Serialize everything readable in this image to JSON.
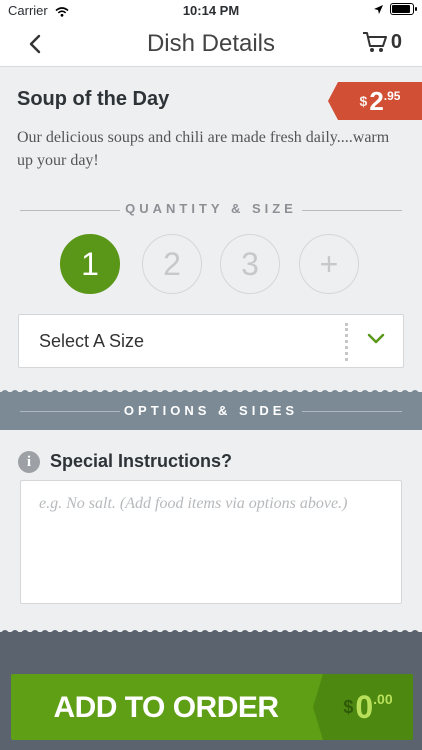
{
  "status_bar": {
    "carrier": "Carrier",
    "time": "10:14 PM"
  },
  "nav": {
    "title": "Dish Details",
    "cart_count": "0"
  },
  "dish": {
    "name": "Soup of the Day",
    "price_currency": "$",
    "price_whole": "2",
    "price_cents": ".95",
    "description": "Our delicious soups and chili are made fresh daily....warm up your day!"
  },
  "quantity": {
    "section_label": "QUANTITY & SIZE",
    "options": [
      "1",
      "2",
      "3",
      "+"
    ],
    "selected": "1"
  },
  "size_select": {
    "value": "Select A Size"
  },
  "options_section": {
    "label": "OPTIONS & SIDES"
  },
  "special_instructions": {
    "label": "Special Instructions?",
    "info_glyph": "i",
    "placeholder": "e.g. No salt. (Add food items via options above.)"
  },
  "add_button": {
    "label": "ADD TO ORDER",
    "total_currency": "$",
    "total_whole": "0",
    "total_cents": ".00"
  },
  "colors": {
    "accent_green": "#5a9618",
    "price_red": "#d14f35",
    "band_gray": "#7c8a95",
    "footer_gray": "#5b646e"
  },
  "icons": [
    "wifi-icon",
    "location-arrow-icon",
    "battery-icon",
    "back-chevron-icon",
    "cart-icon",
    "chevron-down-icon",
    "info-icon"
  ]
}
